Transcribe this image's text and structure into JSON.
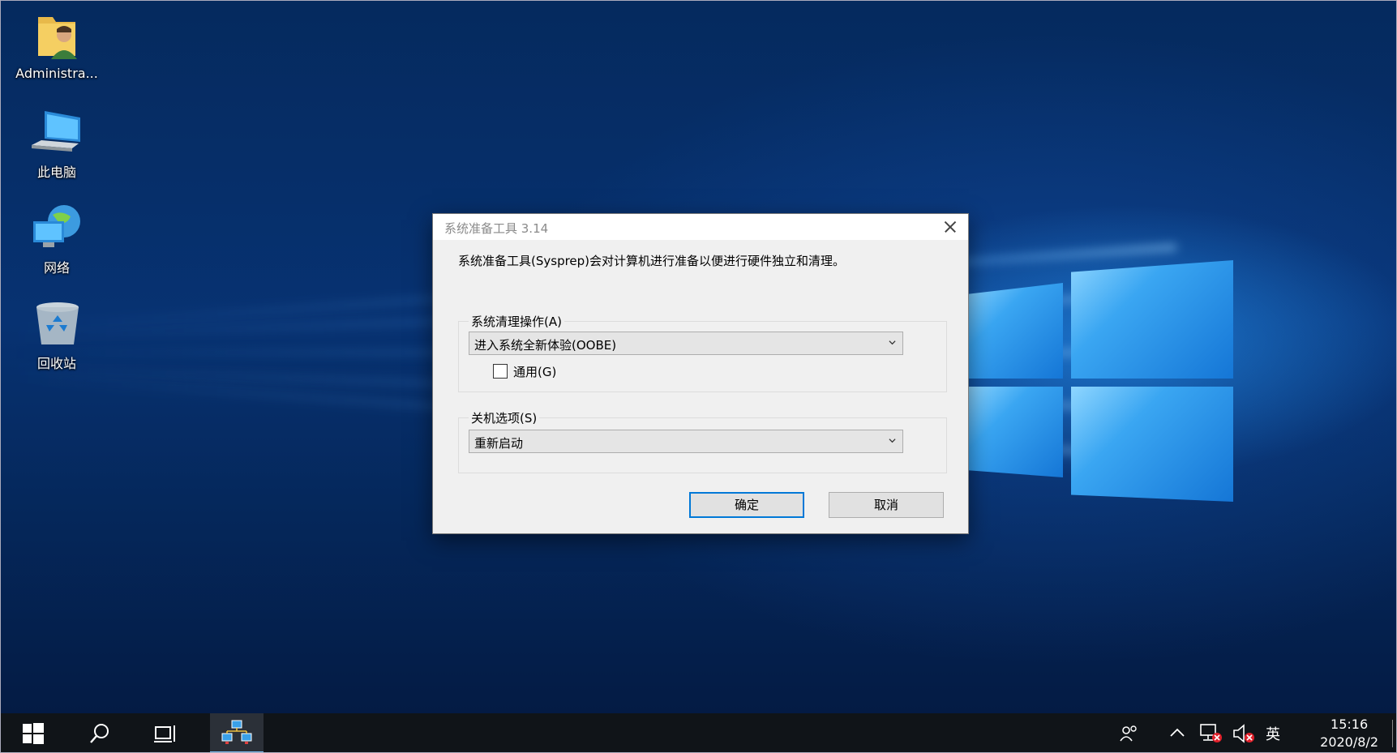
{
  "desktop": {
    "icons": [
      {
        "label": "Administra..."
      },
      {
        "label": "此电脑"
      },
      {
        "label": "网络"
      },
      {
        "label": "回收站"
      }
    ]
  },
  "dialog": {
    "title": "系统准备工具 3.14",
    "description": "系统准备工具(Sysprep)会对计算机进行准备以便进行硬件独立和清理。",
    "cleanup_group": {
      "legend": "系统清理操作(A)",
      "selected": "进入系统全新体验(OOBE)",
      "generalize_label": "通用(G)",
      "generalize_checked": false
    },
    "shutdown_group": {
      "legend": "关机选项(S)",
      "selected": "重新启动"
    },
    "ok_label": "确定",
    "cancel_label": "取消"
  },
  "taskbar": {
    "ime": "英",
    "time": "15:16",
    "date": "2020/8/2"
  },
  "colors": {
    "accent": "#0078d7",
    "taskbar": "#101418",
    "dialog_bg": "#f0f0f0"
  }
}
